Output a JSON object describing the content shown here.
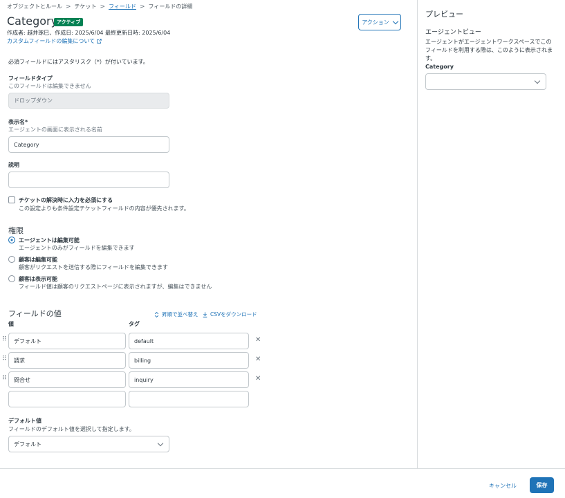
{
  "breadcrumb": {
    "items": [
      "オブジェクトとルール",
      "チケット",
      "フィールド",
      "フィールドの詳細"
    ],
    "separator": ">"
  },
  "header": {
    "title": "Category",
    "status_badge": "アクティブ",
    "meta": "作成者: 越井琢巳、作成日: 2025/6/04 最終更新日時: 2025/6/04",
    "help_link": "カスタムフィールドの編集について",
    "action_button": "アクション"
  },
  "form": {
    "required_note": "必須フィールドにはアスタリスク（*）が付いています。",
    "field_type": {
      "label": "フィールドタイプ",
      "hint": "このフィールドは編集できません",
      "value": "ドロップダウン"
    },
    "display_name": {
      "label": "表示名*",
      "hint": "エージェントの画面に表示される名前",
      "value": "Category"
    },
    "description": {
      "label": "説明",
      "value": ""
    },
    "require_on_solve": {
      "label": "チケットの解決時に入力を必須にする",
      "hint": "この設定よりも条件設定チケットフィールドの内容が優先されます。",
      "checked": false
    }
  },
  "permissions": {
    "title": "権限",
    "options": [
      {
        "label": "エージェントは編集可能",
        "hint": "エージェントのみがフィールドを編集できます",
        "selected": true
      },
      {
        "label": "顧客は編集可能",
        "hint": "顧客がリクエストを送信する際にフィールドを編集できます",
        "selected": false
      },
      {
        "label": "顧客は表示可能",
        "hint": "フィールド値は顧客のリクエストページに表示されますが、編集はできません",
        "selected": false
      }
    ]
  },
  "field_values": {
    "title": "フィールドの値",
    "sort_link": "昇順で並べ替え",
    "csv_link": "CSVをダウンロード",
    "col_value": "値",
    "col_tag": "タグ",
    "rows": [
      {
        "value": "デフォルト",
        "tag": "default"
      },
      {
        "value": "請求",
        "tag": "billing"
      },
      {
        "value": "問合せ",
        "tag": "inquiry"
      },
      {
        "value": "",
        "tag": ""
      }
    ]
  },
  "default_value": {
    "label": "デフォルト値",
    "hint": "フィールドのデフォルト値を選択して指定します。",
    "selected": "デフォルト"
  },
  "preview": {
    "title": "プレビュー",
    "subtitle": "エージェントビュー",
    "description": "エージェントがエージェントワークスペースでこのフィールドを利用する際は、このように表示されます。",
    "field_label": "Category",
    "field_value": ""
  },
  "footer": {
    "cancel": "キャンセル",
    "save": "保存"
  },
  "colors": {
    "accent": "#1f73b7",
    "badge": "#038153"
  }
}
